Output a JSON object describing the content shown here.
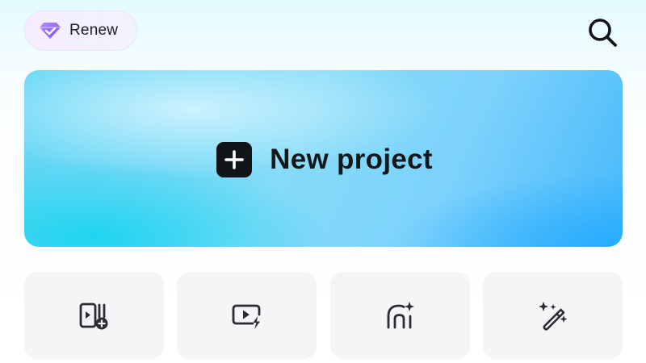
{
  "header": {
    "renew_label": "Renew",
    "renew_icon": "gem-icon",
    "search_icon": "search-icon"
  },
  "banner": {
    "label": "New project",
    "icon": "plus-icon"
  },
  "tools": [
    {
      "icon": "add-clip-icon"
    },
    {
      "icon": "quick-video-icon"
    },
    {
      "icon": "ai-avatar-icon"
    },
    {
      "icon": "magic-wand-icon"
    }
  ],
  "colors": {
    "banner_start": "#5fd5f4",
    "banner_end": "#45b8fb",
    "gem": "#8b5cf6",
    "tile_bg": "#f4f5f7",
    "text": "#15171b"
  }
}
